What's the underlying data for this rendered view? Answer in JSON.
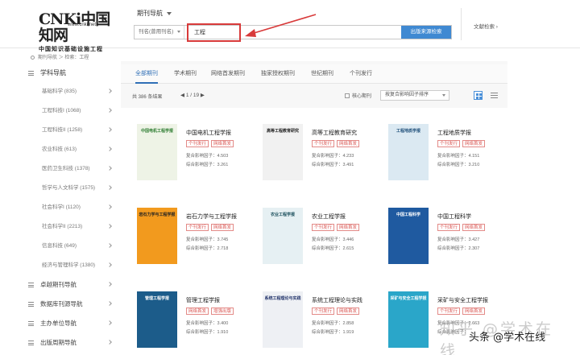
{
  "logo": {
    "big": "CNKi中国知网",
    "url": "www.cnki.net",
    "subtitle": "中国知识基础设施工程"
  },
  "header": {
    "nav_label": "期刊导航",
    "search_field": "刊名(曾用刊名)",
    "search_value": "工程",
    "search_button": "出版来源检索",
    "lit_search": "文献检索"
  },
  "breadcrumb": "期刊导航 ＞ 检索：工程",
  "sidebar": {
    "title": "学科导航",
    "items": [
      "基础科学 (835)",
      "工程科技I (1068)",
      "工程科技II (1258)",
      "农业科技 (613)",
      "医药卫生科技 (1378)",
      "哲学与人文科学 (1575)",
      "社会科学I (1120)",
      "社会科学II (2213)",
      "信息科技 (649)",
      "经济与管理科学 (1380)"
    ],
    "groups": [
      "卓越期刊导航",
      "数据库刊源导航",
      "主办单位导航",
      "出版周期导航"
    ]
  },
  "tabs": [
    "全部期刊",
    "学术期刊",
    "网络首发期刊",
    "独家授权期刊",
    "世纪期刊",
    "个刊发行"
  ],
  "toolbar": {
    "total": "共 386 条结果",
    "page": "1 / 19",
    "core": "核心期刊",
    "sort": "按复合影响因子排序"
  },
  "journals": [
    {
      "name": "中国电机工程学报",
      "tags": [
        "个刊发行",
        "网络首发"
      ],
      "composite_label": "复合影响因子：",
      "composite": "4.503",
      "overall_label": "综合影响因子：",
      "overall": "3.261",
      "cover_title": "中国电机工程学报"
    },
    {
      "name": "高等工程教育研究",
      "tags": [
        "个刊发行",
        "网络首发"
      ],
      "composite_label": "复合影响因子：",
      "composite": "4.233",
      "overall_label": "综合影响因子：",
      "overall": "3.491",
      "cover_title": "高等工程教育研究"
    },
    {
      "name": "工程地质学报",
      "tags": [
        "个刊发行",
        "网络首发"
      ],
      "composite_label": "复合影响因子：",
      "composite": "4.151",
      "overall_label": "综合影响因子：",
      "overall": "3.210",
      "cover_title": "工程地质学报"
    },
    {
      "name": "岩石力学与工程学报",
      "tags": [
        "个刊发行",
        "网络首发"
      ],
      "composite_label": "复合影响因子：",
      "composite": "3.745",
      "overall_label": "综合影响因子：",
      "overall": "2.718",
      "cover_title": "岩石力学与工程学报"
    },
    {
      "name": "农业工程学报",
      "tags": [
        "个刊发行",
        "网络首发"
      ],
      "composite_label": "复合影响因子：",
      "composite": "3.446",
      "overall_label": "综合影响因子：",
      "overall": "2.615",
      "cover_title": "农业工程学报"
    },
    {
      "name": "中国工程科学",
      "tags": [
        "个刊发行",
        "网络首发"
      ],
      "composite_label": "复合影响因子：",
      "composite": "3.427",
      "overall_label": "综合影响因子：",
      "overall": "2.307",
      "cover_title": "中国工程科学"
    },
    {
      "name": "管理工程学报",
      "tags": [
        "网络首发",
        "增强出版"
      ],
      "composite_label": "复合影响因子：",
      "composite": "3.400",
      "overall_label": "综合影响因子：",
      "overall": "1.910",
      "cover_title": "管理工程学报"
    },
    {
      "name": "系统工程理论与实践",
      "tags": [
        "个刊发行",
        "网络首发"
      ],
      "composite_label": "复合影响因子：",
      "composite": "2.858",
      "overall_label": "综合影响因子：",
      "overall": "1.919",
      "cover_title": "系统工程理论与实践"
    },
    {
      "name": "采矿与安全工程学报",
      "tags": [
        "个刊发行",
        "网络首发"
      ],
      "composite_label": "复合影响因子：",
      "composite": "2.663",
      "overall_label": "综合影响因子：",
      "overall": "",
      "cover_title": "采矿与安全工程学报"
    }
  ],
  "watermark": {
    "faint": "知乎 @学术在线",
    "dark": "头条 @学术在线"
  },
  "colors": {
    "accent": "#3f89d2",
    "tag_red": "#d9534f",
    "highlight": "#d83a3a"
  }
}
